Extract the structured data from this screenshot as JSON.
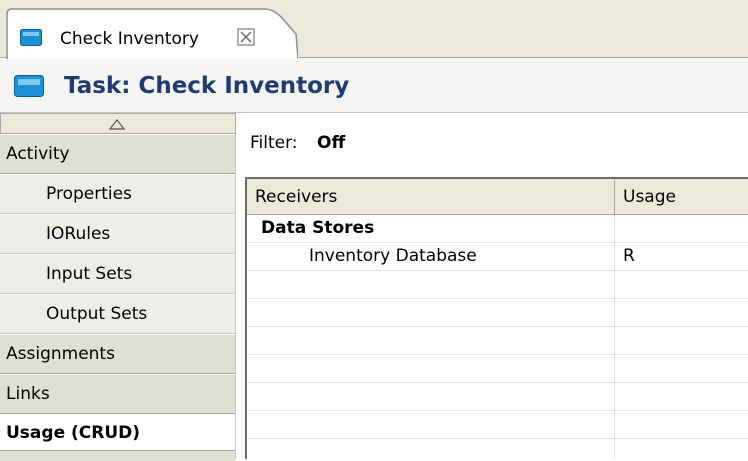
{
  "tab": {
    "title": "Check Inventory",
    "close_glyph": "☒"
  },
  "header": {
    "title": "Task: Check Inventory"
  },
  "sidebar": {
    "scroll_up_icon": "triangle-up-icon",
    "items": [
      {
        "label": "Activity",
        "kind": "group"
      },
      {
        "label": "Properties",
        "kind": "sub"
      },
      {
        "label": "IORules",
        "kind": "sub"
      },
      {
        "label": "Input Sets",
        "kind": "sub"
      },
      {
        "label": "Output Sets",
        "kind": "sub"
      },
      {
        "label": "Assignments",
        "kind": "group"
      },
      {
        "label": "Links",
        "kind": "group"
      },
      {
        "label": "Usage (CRUD)",
        "kind": "selected"
      }
    ]
  },
  "filter": {
    "label": "Filter:",
    "value": "Off"
  },
  "table": {
    "columns": [
      "Receivers",
      "Usage"
    ],
    "rows": [
      {
        "receiver": "Data Stores",
        "usage": "",
        "type": "group"
      },
      {
        "receiver": "Inventory Database",
        "usage": "R",
        "type": "item"
      },
      {
        "receiver": "",
        "usage": "",
        "type": "empty"
      },
      {
        "receiver": "",
        "usage": "",
        "type": "empty"
      },
      {
        "receiver": "",
        "usage": "",
        "type": "empty"
      },
      {
        "receiver": "",
        "usage": "",
        "type": "empty"
      },
      {
        "receiver": "",
        "usage": "",
        "type": "empty"
      },
      {
        "receiver": "",
        "usage": "",
        "type": "empty"
      },
      {
        "receiver": "",
        "usage": "",
        "type": "empty"
      }
    ]
  },
  "colors": {
    "title_blue": "#1f3b73",
    "icon_blue": "#1e90d8",
    "chrome": "#ece9d8"
  }
}
